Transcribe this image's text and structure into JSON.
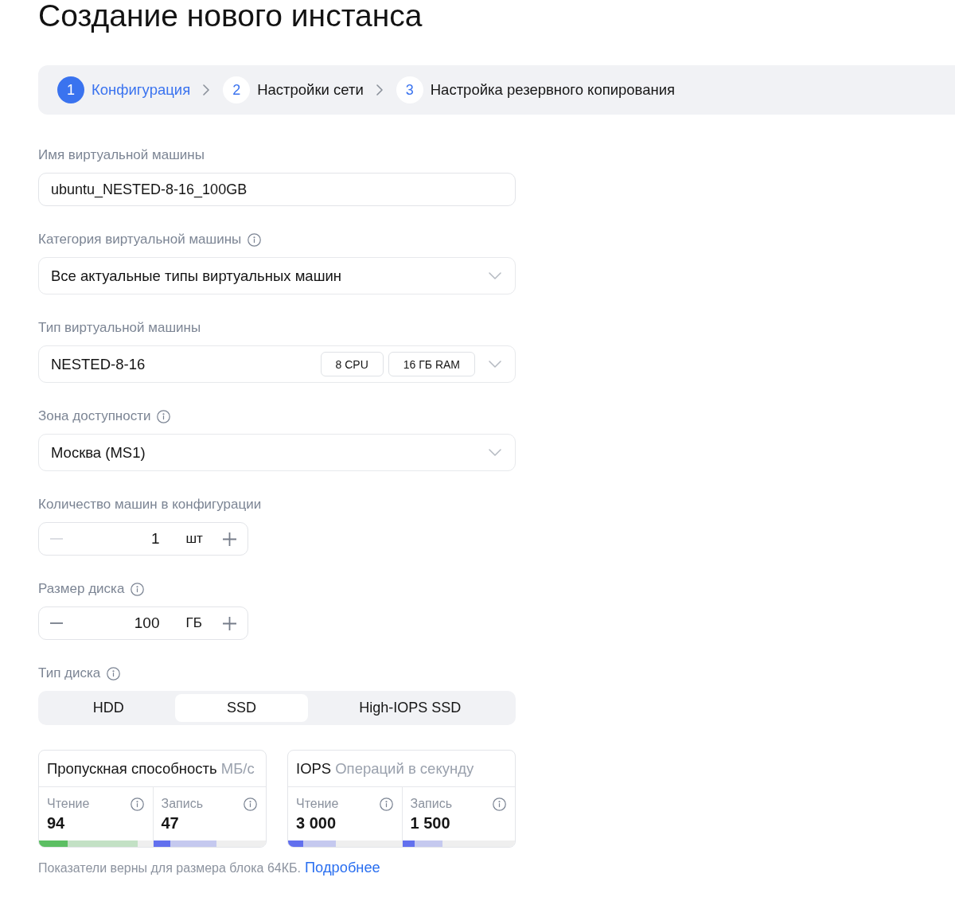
{
  "page": {
    "title": "Создание нового инстанса"
  },
  "steps": [
    {
      "number": "1",
      "label": "Конфигурация",
      "selected": true
    },
    {
      "number": "2",
      "label": "Настройки сети",
      "selected": false
    },
    {
      "number": "3",
      "label": "Настройка резервного копирования",
      "selected": false
    }
  ],
  "fields": [
    {
      "kind": "text",
      "label": "Имя виртуальной машины",
      "info": false,
      "value": "ubuntu_NESTED-8-16_100GB"
    },
    {
      "kind": "select",
      "label": "Категория виртуальной машины",
      "info": true,
      "value": "Все актуальные типы виртуальных машин"
    },
    {
      "kind": "select",
      "label": "Тип виртуальной машины",
      "info": false,
      "value": "NESTED-8-16",
      "chips": [
        "8 CPU",
        "16 ГБ RAM"
      ]
    },
    {
      "kind": "select",
      "label": "Зона доступности",
      "info": true,
      "value": "Москва (MS1)"
    },
    {
      "kind": "counter",
      "label": "Количество машин в конфигурации",
      "info": false,
      "value": "1",
      "unit": "шт",
      "minus_disabled": true
    },
    {
      "kind": "counter",
      "label": "Размер диска",
      "info": true,
      "value": "100",
      "unit": "ГБ",
      "minus_disabled": false
    },
    {
      "kind": "segmented",
      "label": "Тип диска",
      "info": true,
      "options": [
        {
          "label": "HDD",
          "selected": false
        },
        {
          "label": "SSD",
          "selected": true
        },
        {
          "label": "High-IOPS SSD",
          "selected": false
        }
      ]
    }
  ],
  "metrics": [
    {
      "title": "Пропускная способность",
      "unit": "МБ/с",
      "cells": [
        {
          "label": "Чтение",
          "value": "94",
          "color": "#5cbf63",
          "bar": {
            "level": 0.25
          },
          "band": {
            "level": 0.87
          }
        },
        {
          "label": "Запись",
          "value": "47",
          "color": "#6270ee",
          "bar": {
            "level": 0.15
          },
          "band": {
            "level": 0.56
          }
        }
      ]
    },
    {
      "title": "IOPS",
      "unit": "Операций в секунду",
      "cells": [
        {
          "label": "Чтение",
          "value": "3 000",
          "color": "#6270ee",
          "bar": {
            "level": 0.13
          },
          "band": {
            "level": 0.42
          }
        },
        {
          "label": "Запись",
          "value": "1 500",
          "color": "#6270ee",
          "bar": {
            "level": 0.11
          },
          "band": {
            "level": 0.36
          }
        }
      ]
    }
  ],
  "footnote": {
    "text": "Показатели верны для размера блока 64КБ.",
    "link": "Подробнее"
  }
}
